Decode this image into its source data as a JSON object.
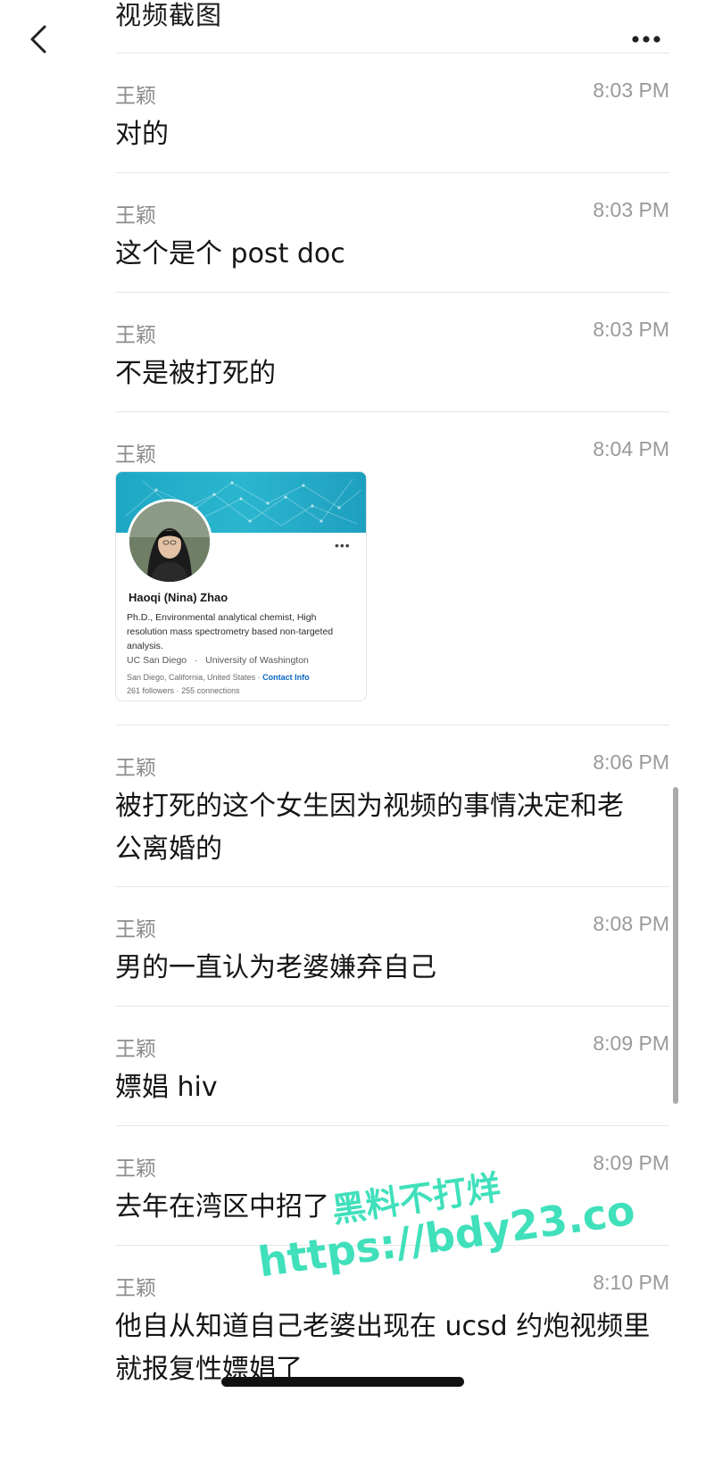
{
  "header": {
    "title": "视频截图"
  },
  "messages": [
    {
      "sender": "王颖",
      "time": "8:03 PM",
      "text": "对的"
    },
    {
      "sender": "王颖",
      "time": "8:03 PM",
      "text": "这个是个 post doc"
    },
    {
      "sender": "王颖",
      "time": "8:03 PM",
      "text": "不是被打死的"
    },
    {
      "sender": "王颖",
      "time": "8:04 PM",
      "text": ""
    },
    {
      "sender": "王颖",
      "time": "8:06 PM",
      "text": "被打死的这个女生因为视频的事情决定和老公离婚的"
    },
    {
      "sender": "王颖",
      "time": "8:08 PM",
      "text": "男的一直认为老婆嫌弃自己"
    },
    {
      "sender": "王颖",
      "time": "8:09 PM",
      "text": "嫖娼 hiv"
    },
    {
      "sender": "王颖",
      "time": "8:09 PM",
      "text": "去年在湾区中招了"
    },
    {
      "sender": "王颖",
      "time": "8:10 PM",
      "text": "他自从知道自己老婆出现在 ucsd 约炮视频里就报复性嫖娼了"
    }
  ],
  "profile_card": {
    "name": "Haoqi (Nina) Zhao",
    "headline": "Ph.D., Environmental analytical chemist, High resolution mass spectrometry based non-targeted analysis.",
    "education_1": "UC San Diego",
    "education_sep": "·",
    "education_2": "University of Washington",
    "location": "San Diego, California, United States",
    "location_sep": "·",
    "contact_label": "Contact Info",
    "followers": "261 followers",
    "stats_sep": "·",
    "connections": "255 connections",
    "more": "•••"
  },
  "watermark": {
    "line1": "黑料不打烊",
    "line2": "https://bdy23.co"
  },
  "icons": {
    "back": "chevron-left-icon",
    "more": "more-horizontal-icon"
  },
  "colors": {
    "text": "#151515",
    "meta": "#8b8b8b",
    "divider": "#e6e6e6",
    "linkedin_blue": "#0a66c2",
    "banner": "#1ea7c4",
    "watermark": "#1fdaaf"
  }
}
